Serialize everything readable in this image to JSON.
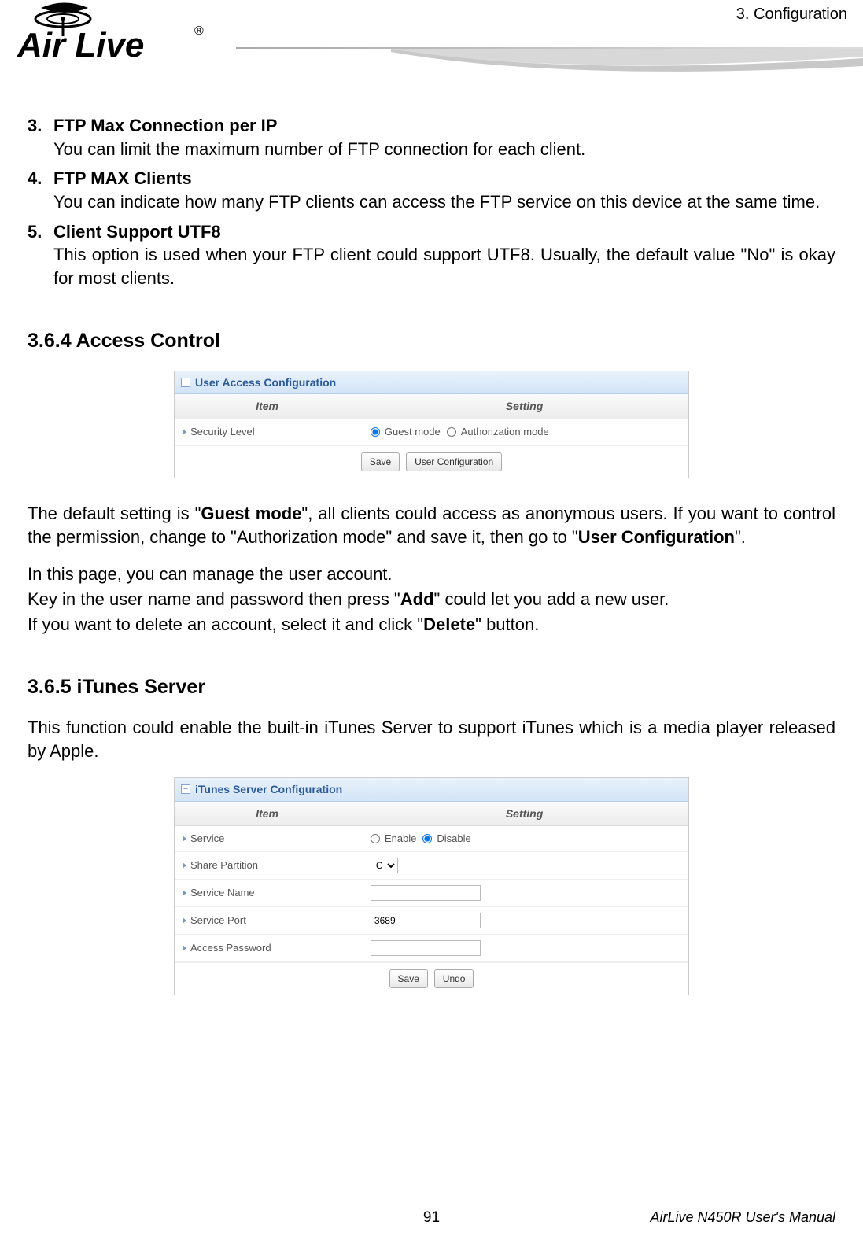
{
  "header": {
    "section_label": "3.  Configuration",
    "logo_text": "Air Live",
    "logo_reg": "®"
  },
  "list": [
    {
      "num": "3.",
      "title": "FTP Max Connection per IP",
      "desc": "You can limit the maximum number of FTP connection for each client."
    },
    {
      "num": "4.",
      "title": "FTP MAX Clients",
      "desc": "You can indicate how many FTP clients can access the FTP service on this device at the same time."
    },
    {
      "num": "5.",
      "title": "Client Support UTF8",
      "desc": "This option is used when your FTP client could support UTF8. Usually, the default value \"No\" is okay for most clients."
    }
  ],
  "section_364": {
    "heading": "3.6.4 Access Control",
    "panel_title": "User Access Configuration",
    "col_item": "Item",
    "col_setting": "Setting",
    "row_label": "Security Level",
    "radio1": "Guest mode",
    "radio2": "Authorization mode",
    "btn_save": "Save",
    "btn_user_config": "User Configuration",
    "para1_pre": "The default setting is \"",
    "para1_bold1": "Guest mode",
    "para1_mid": "\", all clients could access as anonymous users. If you want to control the permission, change to \"Authorization mode\" and save it, then go to \"",
    "para1_bold2": "User Configuration",
    "para1_post": "\".",
    "line1": "In this page, you can manage the user account.",
    "line2_pre": "Key in the user name and password then press \"",
    "line2_bold": "Add",
    "line2_post": "\" could let you add a new user.",
    "line3_pre": "If you want to delete an account, select it and click \"",
    "line3_bold": "Delete",
    "line3_post": "\" button."
  },
  "section_365": {
    "heading": "3.6.5 iTunes Server",
    "intro": "This function could enable the built-in iTunes Server to support iTunes which is a media player released by Apple.",
    "panel_title": "iTunes Server Configuration",
    "col_item": "Item",
    "col_setting": "Setting",
    "rows": {
      "service": {
        "label": "Service",
        "opt1": "Enable",
        "opt2": "Disable"
      },
      "share_partition": {
        "label": "Share Partition",
        "value": "C"
      },
      "service_name": {
        "label": "Service Name",
        "value": ""
      },
      "service_port": {
        "label": "Service Port",
        "value": "3689"
      },
      "access_password": {
        "label": "Access Password",
        "value": ""
      }
    },
    "btn_save": "Save",
    "btn_undo": "Undo"
  },
  "footer": {
    "page": "91",
    "manual": "AirLive N450R User's Manual"
  }
}
